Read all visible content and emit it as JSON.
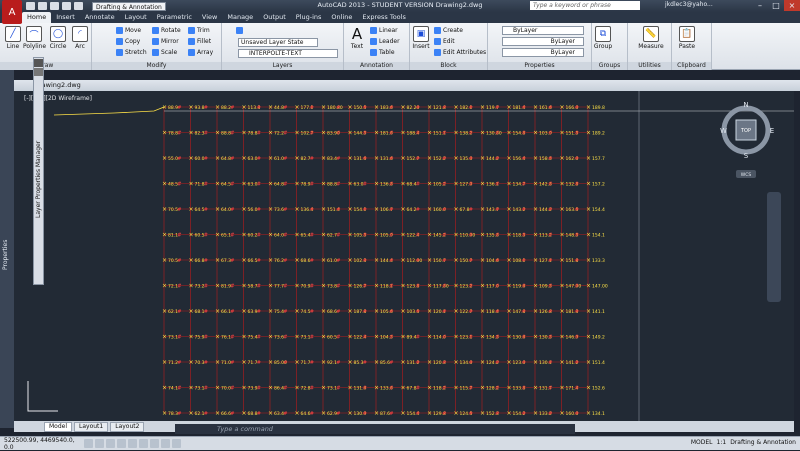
{
  "titlebar": {
    "app_title": "AutoCAD 2013 - STUDENT VERSION    Drawing2.dwg",
    "workspace": "Drafting & Annotation",
    "search_placeholder": "Type a keyword or phrase",
    "user": "jkdlec3@yaho..."
  },
  "tabs": [
    "Home",
    "Insert",
    "Annotate",
    "Layout",
    "Parametric",
    "View",
    "Manage",
    "Output",
    "Plug-ins",
    "Online",
    "Express Tools"
  ],
  "ribbon": {
    "draw": {
      "title": "Draw",
      "line": "Line",
      "polyline": "Polyline",
      "circle": "Circle",
      "arc": "Arc"
    },
    "modify": {
      "title": "Modify",
      "move": "Move",
      "rotate": "Rotate",
      "trim": "Trim",
      "copy": "Copy",
      "mirror": "Mirror",
      "fillet": "Fillet",
      "stretch": "Stretch",
      "scale": "Scale",
      "array": "Array"
    },
    "layers": {
      "title": "Layers",
      "state": "Unsaved Layer State",
      "current": "INTERPOLTE-TEXT"
    },
    "annotation": {
      "title": "Annotation",
      "text": "Text",
      "linear": "Linear",
      "leader": "Leader",
      "table": "Table"
    },
    "block": {
      "title": "Block",
      "insert": "Insert",
      "create": "Create",
      "edit": "Edit",
      "edit_attributes": "Edit Attributes"
    },
    "properties": {
      "title": "Properties",
      "color": "ByLayer",
      "linetype": "ByLayer",
      "lineweight": "ByLayer"
    },
    "groups": {
      "title": "Groups",
      "group": "Group"
    },
    "utilities": {
      "title": "Utilities",
      "measure": "Measure"
    },
    "clipboard": {
      "title": "Clipboard",
      "paste": "Paste"
    }
  },
  "palette_title": "Layer Properties Manager",
  "left_bar_title": "Properties",
  "drawing": {
    "tab": "Drawing2.dwg",
    "viewport_label": "[-][Top][2D Wireframe]"
  },
  "grid_values": [
    [
      "88.9",
      "93.8",
      "88.2",
      "113.3",
      "44.8",
      "177.1",
      "180.80",
      "150.5",
      "183.6",
      "82.20",
      "121.8",
      "182.1",
      "119.7",
      "181.4",
      "161.6",
      "166.0",
      "189.8"
    ],
    [
      "78.8",
      "82.3",
      "88.8",
      "78.8",
      "72.2",
      "102.7",
      "83.90",
      "144.5",
      "181.6",
      "188.4",
      "151.1",
      "138.2",
      "130.80",
      "154.8",
      "103.9",
      "151.5",
      "189.2"
    ],
    [
      "55.0",
      "60.0",
      "64.8",
      "63.0",
      "61.0",
      "82.7",
      "83.4",
      "131.6",
      "131.6",
      "152.7",
      "152.2",
      "135.0",
      "144.2",
      "156.4",
      "158.5",
      "162.0",
      "157.7"
    ],
    [
      "48.5",
      "71.8",
      "64.5",
      "63.0",
      "64.8",
      "78.9",
      "88.8",
      "63.0",
      "136.8",
      "68.4",
      "105.2",
      "127.0",
      "136.1",
      "134.7",
      "142.8",
      "132.8",
      "157.2"
    ],
    [
      "70.5",
      "64.5",
      "64.0",
      "56.0",
      "73.6",
      "136.4",
      "151.4",
      "154.1",
      "106.7",
      "64.2",
      "160.0",
      "67.8",
      "143.7",
      "143.2",
      "144.2",
      "163.5",
      "154.4"
    ],
    [
      "81.1",
      "60.5",
      "65.1",
      "60.2",
      "64.0",
      "65.4",
      "62.7",
      "105.5",
      "105.9",
      "122.4",
      "145.2",
      "110.00",
      "135.8",
      "118.3",
      "113.2",
      "148.5",
      "154.1"
    ],
    [
      "70.5",
      "66.8",
      "67.3",
      "66.5",
      "76.2",
      "68.6",
      "61.0",
      "102.3",
      "144.4",
      "112.00",
      "150.7",
      "150.7",
      "104.6",
      "108.1",
      "127.1",
      "151.8",
      "133.3"
    ],
    [
      "72.1",
      "73.2",
      "81.9",
      "58.7",
      "77.7",
      "70.9",
      "73.8",
      "126.7",
      "118.1",
      "123.8",
      "117.80",
      "123.2",
      "117.0",
      "119.6",
      "109.3",
      "147.00",
      "147.00"
    ],
    [
      "62.1",
      "68.1",
      "66.1",
      "63.9",
      "75.4",
      "74.5",
      "68.6",
      "187.8",
      "105.6",
      "103.5",
      "120.1",
      "122.7",
      "118.4",
      "147.8",
      "126.8",
      "181.3",
      "141.1"
    ],
    [
      "73.1",
      "75.9",
      "76.1",
      "75.4",
      "73.6",
      "73.1",
      "60.5",
      "122.4",
      "104.3",
      "89.4",
      "114.0",
      "123.1",
      "134.3",
      "130.6",
      "130.3",
      "146.9",
      "149.2"
    ],
    [
      "71.2",
      "70.3",
      "71.0",
      "71.7",
      "85.00",
      "71.7",
      "92.1",
      "85.3",
      "85.6",
      "131.2",
      "120.3",
      "134.0",
      "124.2",
      "123.0",
      "130.1",
      "141.2",
      "151.4"
    ],
    [
      "74.1",
      "73.1",
      "70.0",
      "73.9",
      "86.4",
      "72.8",
      "73.1",
      "131.6",
      "133.6",
      "67.8",
      "118.2",
      "115.7",
      "128.2",
      "133.8",
      "131.7",
      "171.4",
      "152.6"
    ],
    [
      "78.3",
      "62.1",
      "66.6",
      "68.8",
      "63.4",
      "64.6",
      "62.9",
      "130.9",
      "87.6",
      "154.4",
      "129.8",
      "124.5",
      "152.3",
      "154.2",
      "133.2",
      "160.0",
      "134.1"
    ]
  ],
  "layout_tabs": [
    "Model",
    "Layout1",
    "Layout2"
  ],
  "command_placeholder": "Type a command",
  "status": {
    "coords": "522500.99, 4469540.0, 0.0",
    "model": "MODEL",
    "scale": "1:1",
    "workspace": "Drafting & Annotation"
  },
  "navcube": {
    "n": "N",
    "s": "S",
    "e": "E",
    "w": "W",
    "top": "TOP",
    "wcs": "WCS"
  }
}
